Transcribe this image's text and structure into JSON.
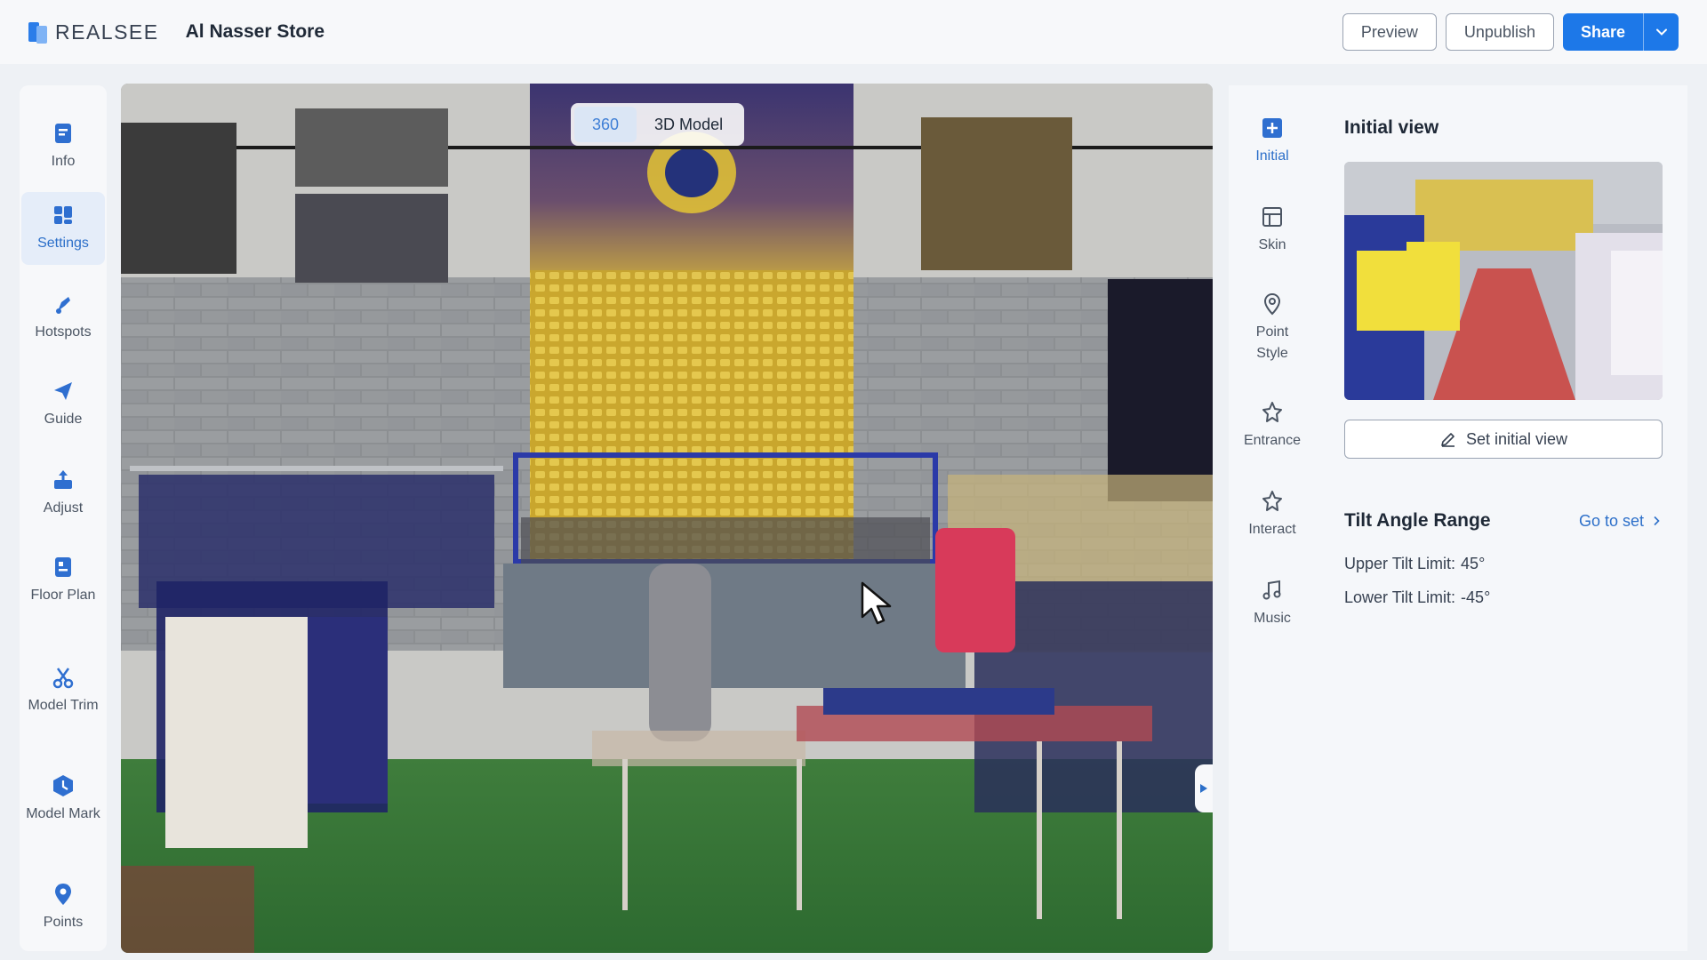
{
  "header": {
    "logo_text": "REALSEE",
    "store_title": "Al Nasser Store",
    "preview_label": "Preview",
    "unpublish_label": "Unpublish",
    "share_label": "Share"
  },
  "left_sidebar": {
    "items": [
      {
        "label": "Info",
        "icon": "info-icon"
      },
      {
        "label": "Settings",
        "icon": "settings-icon",
        "active": true
      },
      {
        "label": "Hotspots",
        "icon": "hotspots-icon"
      },
      {
        "label": "Guide",
        "icon": "guide-icon"
      },
      {
        "label": "Adjust",
        "icon": "adjust-icon"
      },
      {
        "label": "Floor Plan",
        "icon": "floor-plan-icon"
      },
      {
        "label": "Model Trim",
        "icon": "model-trim-icon"
      },
      {
        "label": "Model Mark",
        "icon": "model-mark-icon"
      },
      {
        "label": "Points",
        "icon": "points-icon"
      }
    ]
  },
  "viewer": {
    "view_modes": [
      {
        "label": "360",
        "active": true
      },
      {
        "label": "3D Model",
        "active": false
      }
    ]
  },
  "right_rail": {
    "items": [
      {
        "label": "Initial",
        "icon": "initial-icon",
        "active": true
      },
      {
        "label": "Skin",
        "icon": "skin-icon"
      },
      {
        "label": "Point Style",
        "icon": "point-style-icon"
      },
      {
        "label": "Entrance",
        "icon": "entrance-icon"
      },
      {
        "label": "Interact",
        "icon": "interact-icon"
      },
      {
        "label": "Music",
        "icon": "music-icon"
      }
    ]
  },
  "panel": {
    "initial_view_title": "Initial view",
    "set_initial_view_label": "Set initial view",
    "tilt_title": "Tilt Angle Range",
    "go_to_set_label": "Go to set",
    "upper_tilt_label": "Upper Tilt Limit:",
    "upper_tilt_value": "45°",
    "lower_tilt_label": "Lower Tilt Limit:",
    "lower_tilt_value": "-45°"
  },
  "colors": {
    "accent": "#1d78e8",
    "active_text": "#2c6fc9",
    "active_bg": "#e5edf9"
  }
}
